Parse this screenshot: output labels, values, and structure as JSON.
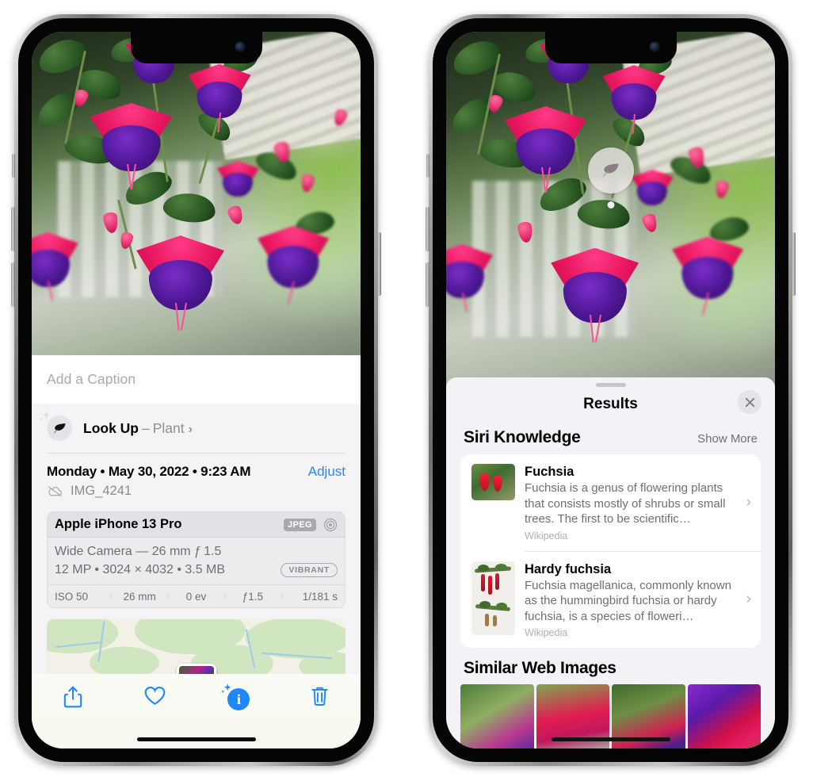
{
  "left_phone": {
    "caption_field": {
      "placeholder": "Add a Caption",
      "value": ""
    },
    "lookup": {
      "label": "Look Up",
      "dash": "–",
      "subject": "Plant",
      "chevron": "›",
      "icon": "leaf-icon"
    },
    "date_line": "Monday • May 30, 2022 • 9:23 AM",
    "adjust_label": "Adjust",
    "filename": "IMG_4241",
    "cloud_icon": "icloud-slash-icon",
    "metadata": {
      "device": "Apple iPhone 13 Pro",
      "format_badge": "JPEG",
      "lens_icon": "aperture-icon",
      "lens_line": "Wide Camera — 26 mm ƒ 1.5",
      "specs_line": "12 MP • 3024 × 4032 • 3.5 MB",
      "style_badge": "VIBRANT",
      "exif": [
        "ISO 50",
        "26 mm",
        "0 ev",
        "ƒ1.5",
        "1/181 s"
      ]
    },
    "map": {
      "pin": "photo-pin"
    },
    "toolbar": [
      {
        "name": "share-button",
        "icon": "share-icon"
      },
      {
        "name": "favorite-button",
        "icon": "heart-icon"
      },
      {
        "name": "info-button",
        "icon": "info-sparkle-icon",
        "glyph": "i"
      },
      {
        "name": "delete-button",
        "icon": "trash-icon"
      }
    ]
  },
  "right_phone": {
    "visual_lookup_badge": {
      "icon": "leaf-icon"
    },
    "sheet": {
      "title": "Results",
      "close_label": "✕",
      "sections": [
        {
          "title": "Siri Knowledge",
          "action": "Show More",
          "items": [
            {
              "title": "Fuchsia",
              "description": "Fuchsia is a genus of flowering plants that consists mostly of shrubs or small trees. The first to be scientific…",
              "source": "Wikipedia",
              "chevron": "›"
            },
            {
              "title": "Hardy fuchsia",
              "description": "Fuchsia magellanica, commonly known as the hummingbird fuchsia or hardy fuchsia, is a species of floweri…",
              "source": "Wikipedia",
              "chevron": "›"
            }
          ]
        },
        {
          "title": "Similar Web Images",
          "tiles": [
            "web-image-1",
            "web-image-2",
            "web-image-3",
            "web-image-4"
          ]
        }
      ]
    }
  },
  "colors": {
    "accent_blue": "#1e88ff",
    "sheet_bg": "#f2f2f7",
    "card_white": "#ffffff",
    "secondary_text": "#6f6f75",
    "tertiary_text": "#aeaeb3"
  }
}
